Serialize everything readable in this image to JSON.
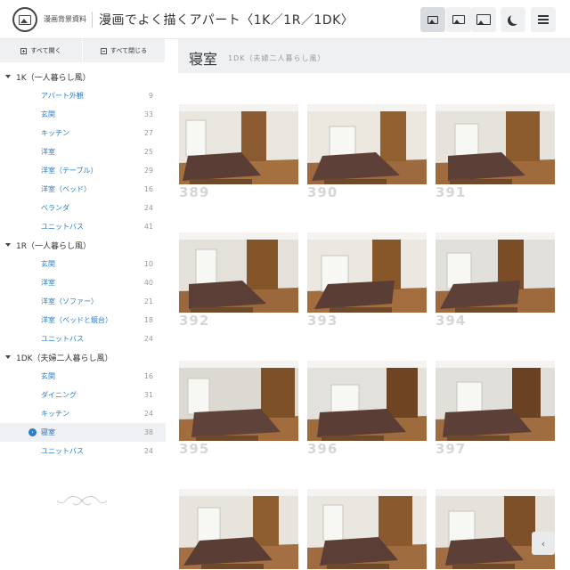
{
  "header": {
    "site_name": "漫画背景資料",
    "title": "漫画でよく描くアパート〈1K／1R／1DK〉",
    "icons": [
      "small-image-icon",
      "medium-image-icon",
      "large-image-icon",
      "moon-icon",
      "menu-icon"
    ]
  },
  "sidebar": {
    "expand_all": "すべて開く",
    "collapse_all": "すべて閉じる",
    "categories": [
      {
        "label": "1K（一人暮らし風）",
        "items": [
          {
            "label": "アパート外観",
            "count": "9"
          },
          {
            "label": "玄関",
            "count": "33"
          },
          {
            "label": "キッチン",
            "count": "27"
          },
          {
            "label": "洋室",
            "count": "25"
          },
          {
            "label": "洋室（テーブル）",
            "count": "29"
          },
          {
            "label": "洋室（ベッド）",
            "count": "16"
          },
          {
            "label": "ベランダ",
            "count": "24"
          },
          {
            "label": "ユニットバス",
            "count": "41"
          }
        ]
      },
      {
        "label": "1R（一人暮らし風）",
        "items": [
          {
            "label": "玄関",
            "count": "10"
          },
          {
            "label": "洋室",
            "count": "40"
          },
          {
            "label": "洋室（ソファー）",
            "count": "21"
          },
          {
            "label": "洋室（ベッドと鏡台）",
            "count": "18"
          },
          {
            "label": "ユニットバス",
            "count": "24"
          }
        ]
      },
      {
        "label": "1DK（夫婦二人暮らし風）",
        "items": [
          {
            "label": "玄関",
            "count": "16"
          },
          {
            "label": "ダイニング",
            "count": "31"
          },
          {
            "label": "キッチン",
            "count": "24"
          },
          {
            "label": "寝室",
            "count": "38"
          },
          {
            "label": "ユニットバス",
            "count": "24"
          }
        ]
      }
    ]
  },
  "main": {
    "title": "寝室",
    "subtitle": "1DK（夫婦二人暮らし風）",
    "thumbnails": [
      "389",
      "390",
      "391",
      "392",
      "393",
      "394",
      "395",
      "396",
      "397",
      "",
      "",
      ""
    ]
  },
  "colors": {
    "accent": "#2a7cc7",
    "header_bg": "#eef0f2"
  }
}
